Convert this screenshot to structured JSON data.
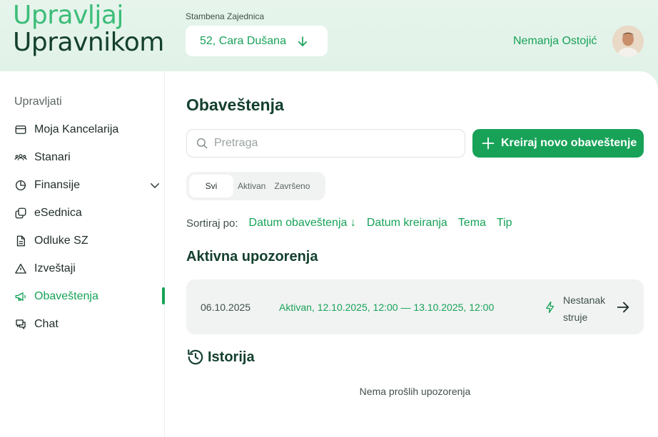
{
  "brand": {
    "line1": "Upravljaj",
    "line2": "Upravnikom"
  },
  "community": {
    "label": "Stambena Zajednica",
    "selected": "52, Cara Dušana"
  },
  "user": {
    "name": "Nemanja Ostojić"
  },
  "sidebar": {
    "section": "Upravljati",
    "items": [
      {
        "label": "Moja Kancelarija",
        "icon": "wallet-icon"
      },
      {
        "label": "Stanari",
        "icon": "users-icon"
      },
      {
        "label": "Finansije",
        "icon": "pie-chart-icon"
      },
      {
        "label": "eSednica",
        "icon": "copy-icon"
      },
      {
        "label": "Odluke SZ",
        "icon": "document-icon"
      },
      {
        "label": "Izveštaji",
        "icon": "warning-icon"
      },
      {
        "label": "Obaveštenja",
        "icon": "megaphone-icon"
      },
      {
        "label": "Chat",
        "icon": "chat-icon"
      }
    ],
    "active": "Obaveštenja"
  },
  "main": {
    "title": "Obaveštenja",
    "search_placeholder": "Pretraga",
    "create_label": "Kreiraj novo obaveštenje",
    "tabs": [
      {
        "label": "Svi"
      },
      {
        "label": "Aktivan"
      },
      {
        "label": "Završeno"
      }
    ],
    "active_tab": "Svi",
    "sort": {
      "label": "Sortiraj po:",
      "options": [
        "Datum obaveštenja ↓",
        "Datum kreiranja",
        "Tema",
        "Tip"
      ]
    },
    "active_section_title": "Aktivna upozorenja",
    "alert": {
      "date": "06.10.2025",
      "status": "Aktivan, 12.10.2025, 12:00 — 13.10.2025, 12:00",
      "type": "Nestanak struje"
    },
    "history_title": "Istorija",
    "history_empty": "Nema prošlih upozorenja"
  },
  "colors": {
    "accent": "#17a258",
    "dark_green": "#14402e",
    "light_green": "#3cbd79"
  }
}
